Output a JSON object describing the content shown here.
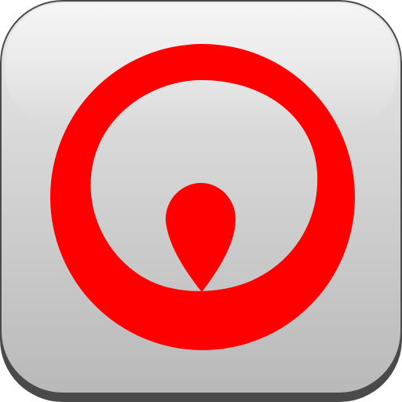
{
  "app_icon": {
    "icon": "logo-ring-teardrop-icon",
    "colors": {
      "logo": "#ff0000",
      "tile_top": "#e9e9e9",
      "tile_bottom": "#b9b9b9",
      "tile_border": "#4a4a4a",
      "tile_highlight": "#f7f7f7"
    }
  }
}
